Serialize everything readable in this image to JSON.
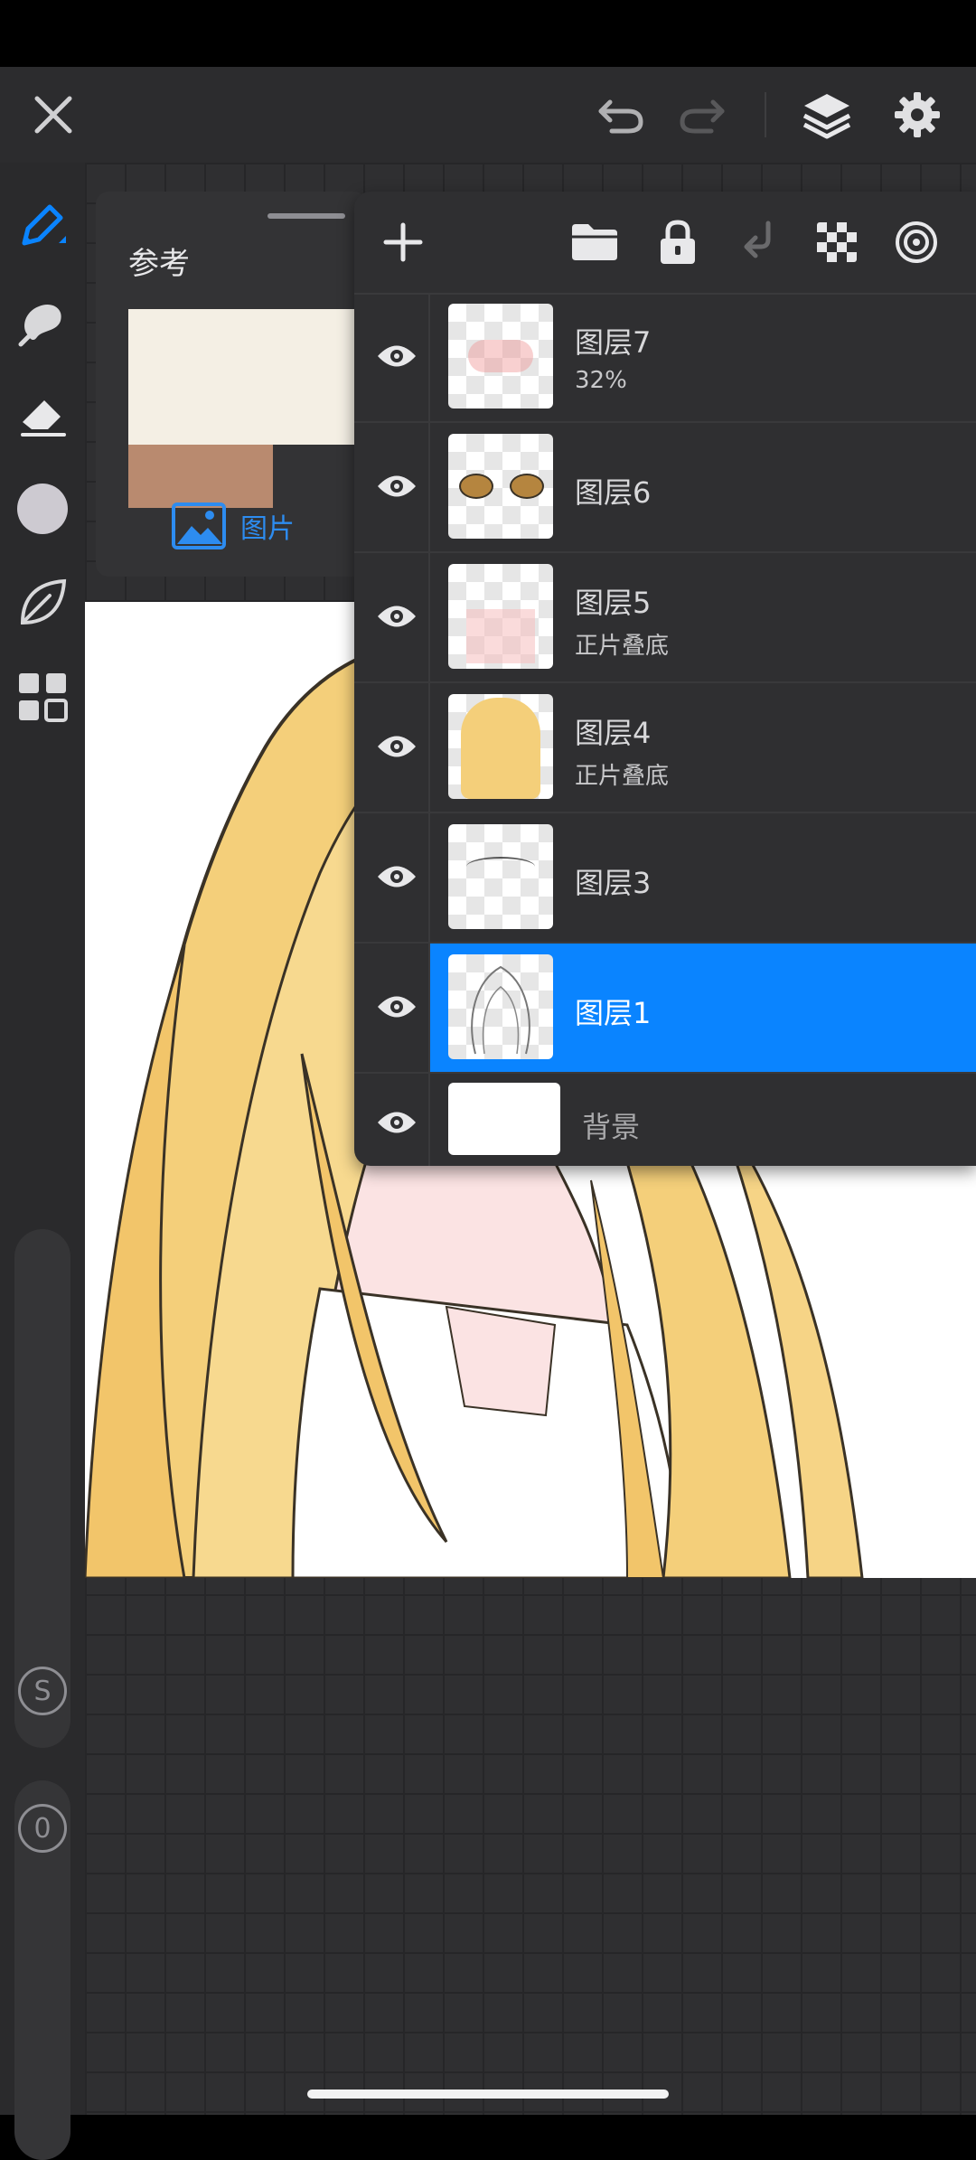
{
  "reference": {
    "title": "参考",
    "tab_image_label": "图片"
  },
  "layers": [
    {
      "name": "图层7",
      "sub": "32%"
    },
    {
      "name": "图层6",
      "sub": ""
    },
    {
      "name": "图层5",
      "sub": "正片叠底"
    },
    {
      "name": "图层4",
      "sub": "正片叠底"
    },
    {
      "name": "图层3",
      "sub": ""
    },
    {
      "name": "图层1",
      "sub": "",
      "selected": true
    },
    {
      "name": "背景",
      "sub": ""
    }
  ],
  "sidebar": {
    "brush_size_label": "S",
    "opacity_label": "0"
  },
  "colors": {
    "accent": "#0a84ff",
    "panel": "#2f2f31",
    "toolbar": "#2c2c2e"
  }
}
